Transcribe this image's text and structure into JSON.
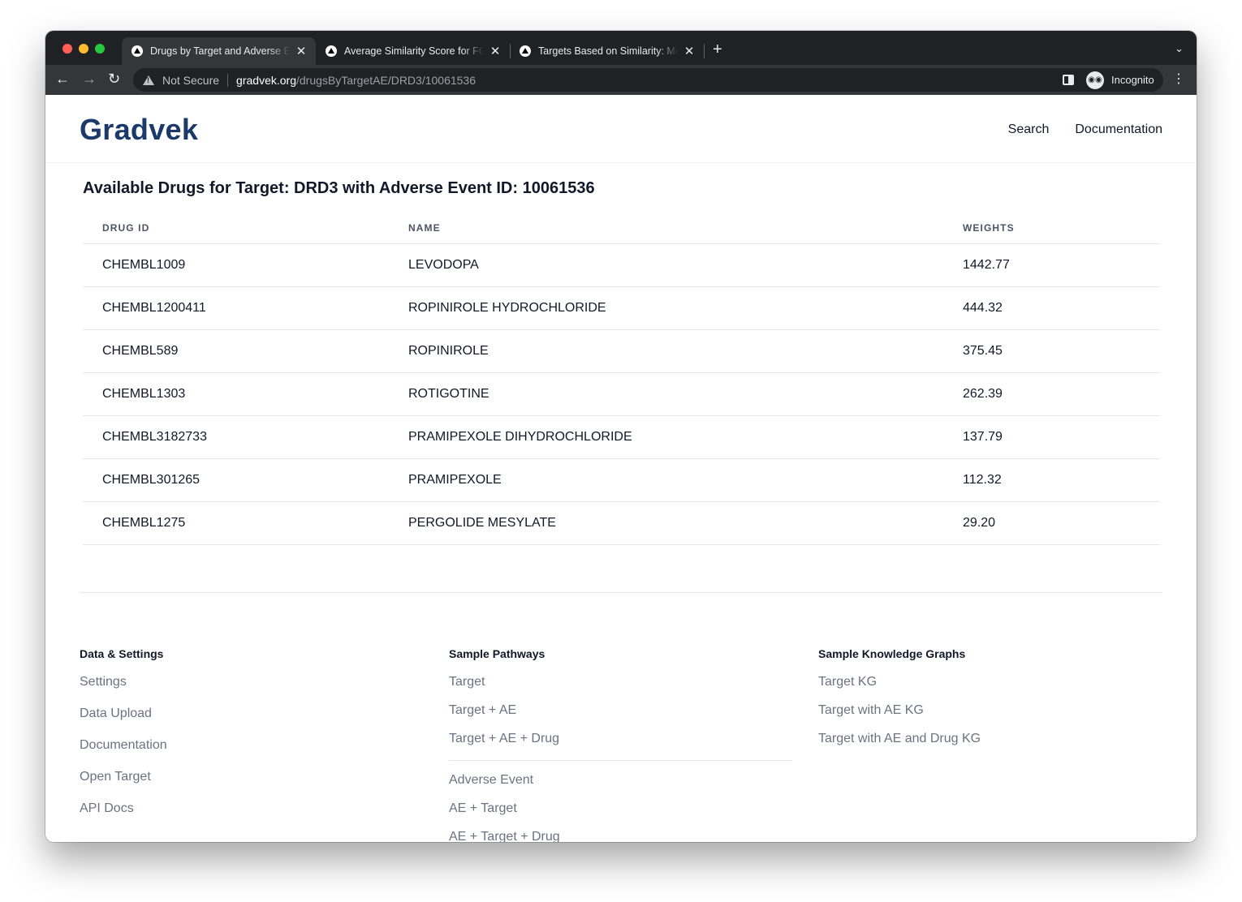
{
  "browser": {
    "tabs": [
      {
        "title": "Drugs by Target and Adverse Event",
        "active": true
      },
      {
        "title": "Average Similarity Score for FGFR",
        "active": false
      },
      {
        "title": "Targets Based on Similarity: Most",
        "active": false
      }
    ],
    "new_tab_label": "+",
    "security_label": "Not Secure",
    "url_host": "gradvek.org",
    "url_path": "/drugsByTargetAE/DRD3/10061536",
    "profile_label": "Incognito"
  },
  "header": {
    "logo": "Gradvek",
    "nav": [
      "Search",
      "Documentation"
    ]
  },
  "main": {
    "heading": "Available Drugs for Target: DRD3 with Adverse Event ID: 10061536",
    "columns": [
      "DRUG ID",
      "NAME",
      "WEIGHTS"
    ],
    "rows": [
      {
        "id": "CHEMBL1009",
        "name": "LEVODOPA",
        "weight": "1442.77"
      },
      {
        "id": "CHEMBL1200411",
        "name": "ROPINIROLE HYDROCHLORIDE",
        "weight": "444.32"
      },
      {
        "id": "CHEMBL589",
        "name": "ROPINIROLE",
        "weight": "375.45"
      },
      {
        "id": "CHEMBL1303",
        "name": "ROTIGOTINE",
        "weight": "262.39"
      },
      {
        "id": "CHEMBL3182733",
        "name": "PRAMIPEXOLE DIHYDROCHLORIDE",
        "weight": "137.79"
      },
      {
        "id": "CHEMBL301265",
        "name": "PRAMIPEXOLE",
        "weight": "112.32"
      },
      {
        "id": "CHEMBL1275",
        "name": "PERGOLIDE MESYLATE",
        "weight": "29.20"
      }
    ]
  },
  "footer": {
    "data_settings": {
      "heading": "Data & Settings",
      "links": [
        "Settings",
        "Data Upload",
        "Documentation",
        "Open Target",
        "API Docs"
      ]
    },
    "pathways": {
      "heading": "Sample Pathways",
      "group1": [
        "Target",
        "Target + AE",
        "Target + AE + Drug"
      ],
      "group2": [
        "Adverse Event",
        "AE + Target",
        "AE + Target + Drug"
      ]
    },
    "knowledge_graphs": {
      "heading": "Sample Knowledge Graphs",
      "links": [
        "Target KG",
        "Target with AE KG",
        "Target with AE and Drug KG"
      ]
    }
  },
  "colors": {
    "logo": "#1b3a6b",
    "footer_link": "#6b7280",
    "chrome_dark": "#202124",
    "chrome_toolbar": "#35363a"
  }
}
